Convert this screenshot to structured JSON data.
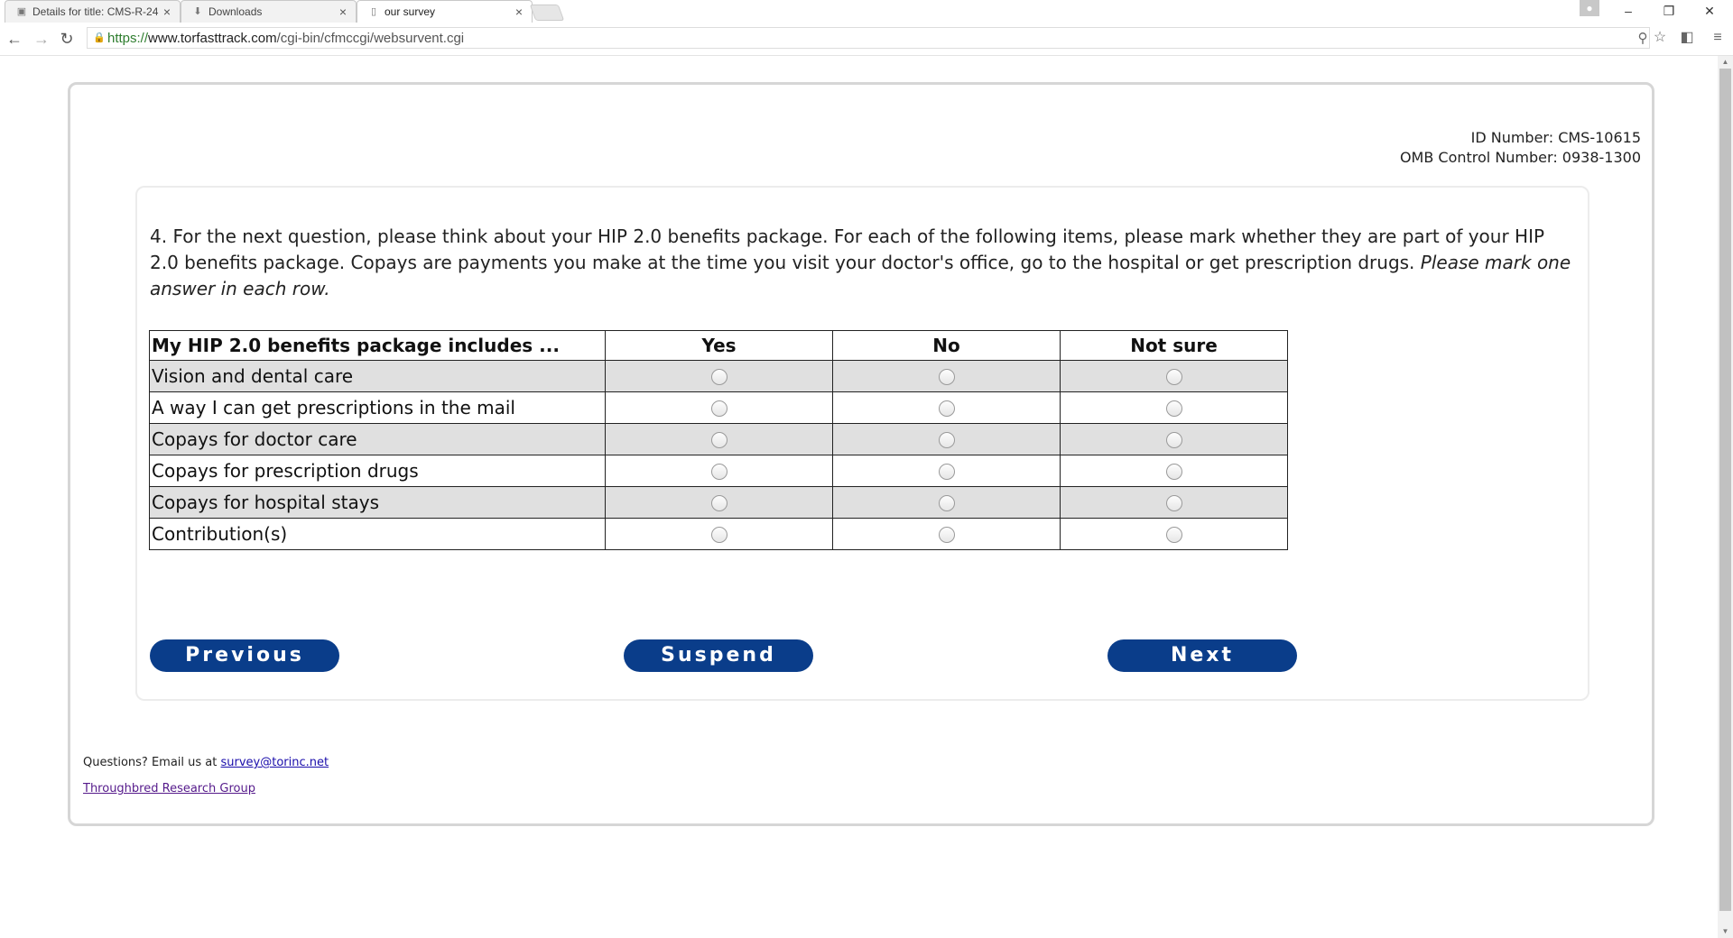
{
  "browser": {
    "tabs": [
      {
        "title": "Details for title: CMS-R-24",
        "icon": "cms-favicon"
      },
      {
        "title": "Downloads",
        "icon": "download-icon"
      },
      {
        "title": "our survey",
        "icon": "page-icon"
      }
    ],
    "url": {
      "scheme": "https://",
      "host": "www.torfasttrack.com",
      "path": "/cgi-bin/cfmccgi/websurvent.cgi"
    }
  },
  "header": {
    "id_number": "ID Number: CMS-10615",
    "omb_control": "OMB Control Number: 0938-1300"
  },
  "question": {
    "text": "4. For the next question, please think about your HIP 2.0 benefits package. For each of the following items, please mark whether they are part of your HIP 2.0 benefits package. Copays are payments you make at the time you visit your doctor's office, go to the hospital or get prescription drugs. ",
    "instruction": "Please mark one answer in each row."
  },
  "grid": {
    "header": "My HIP 2.0 benefits package includes ...",
    "options": [
      "Yes",
      "No",
      "Not sure"
    ],
    "rows": [
      "Vision and dental care",
      "A way I can get prescriptions in the mail",
      "Copays for doctor care",
      "Copays for prescription drugs",
      "Copays for hospital stays",
      "Contribution(s)"
    ]
  },
  "buttons": {
    "previous": "Previous",
    "suspend": "Suspend",
    "next": "Next"
  },
  "footer": {
    "questions_prefix": "Questions? Email us at ",
    "email": "survey@torinc.net",
    "org_link": "Throughbred Research Group"
  },
  "colors": {
    "button_bg": "#0a3d8a",
    "row_shade": "#e0e0e0"
  }
}
